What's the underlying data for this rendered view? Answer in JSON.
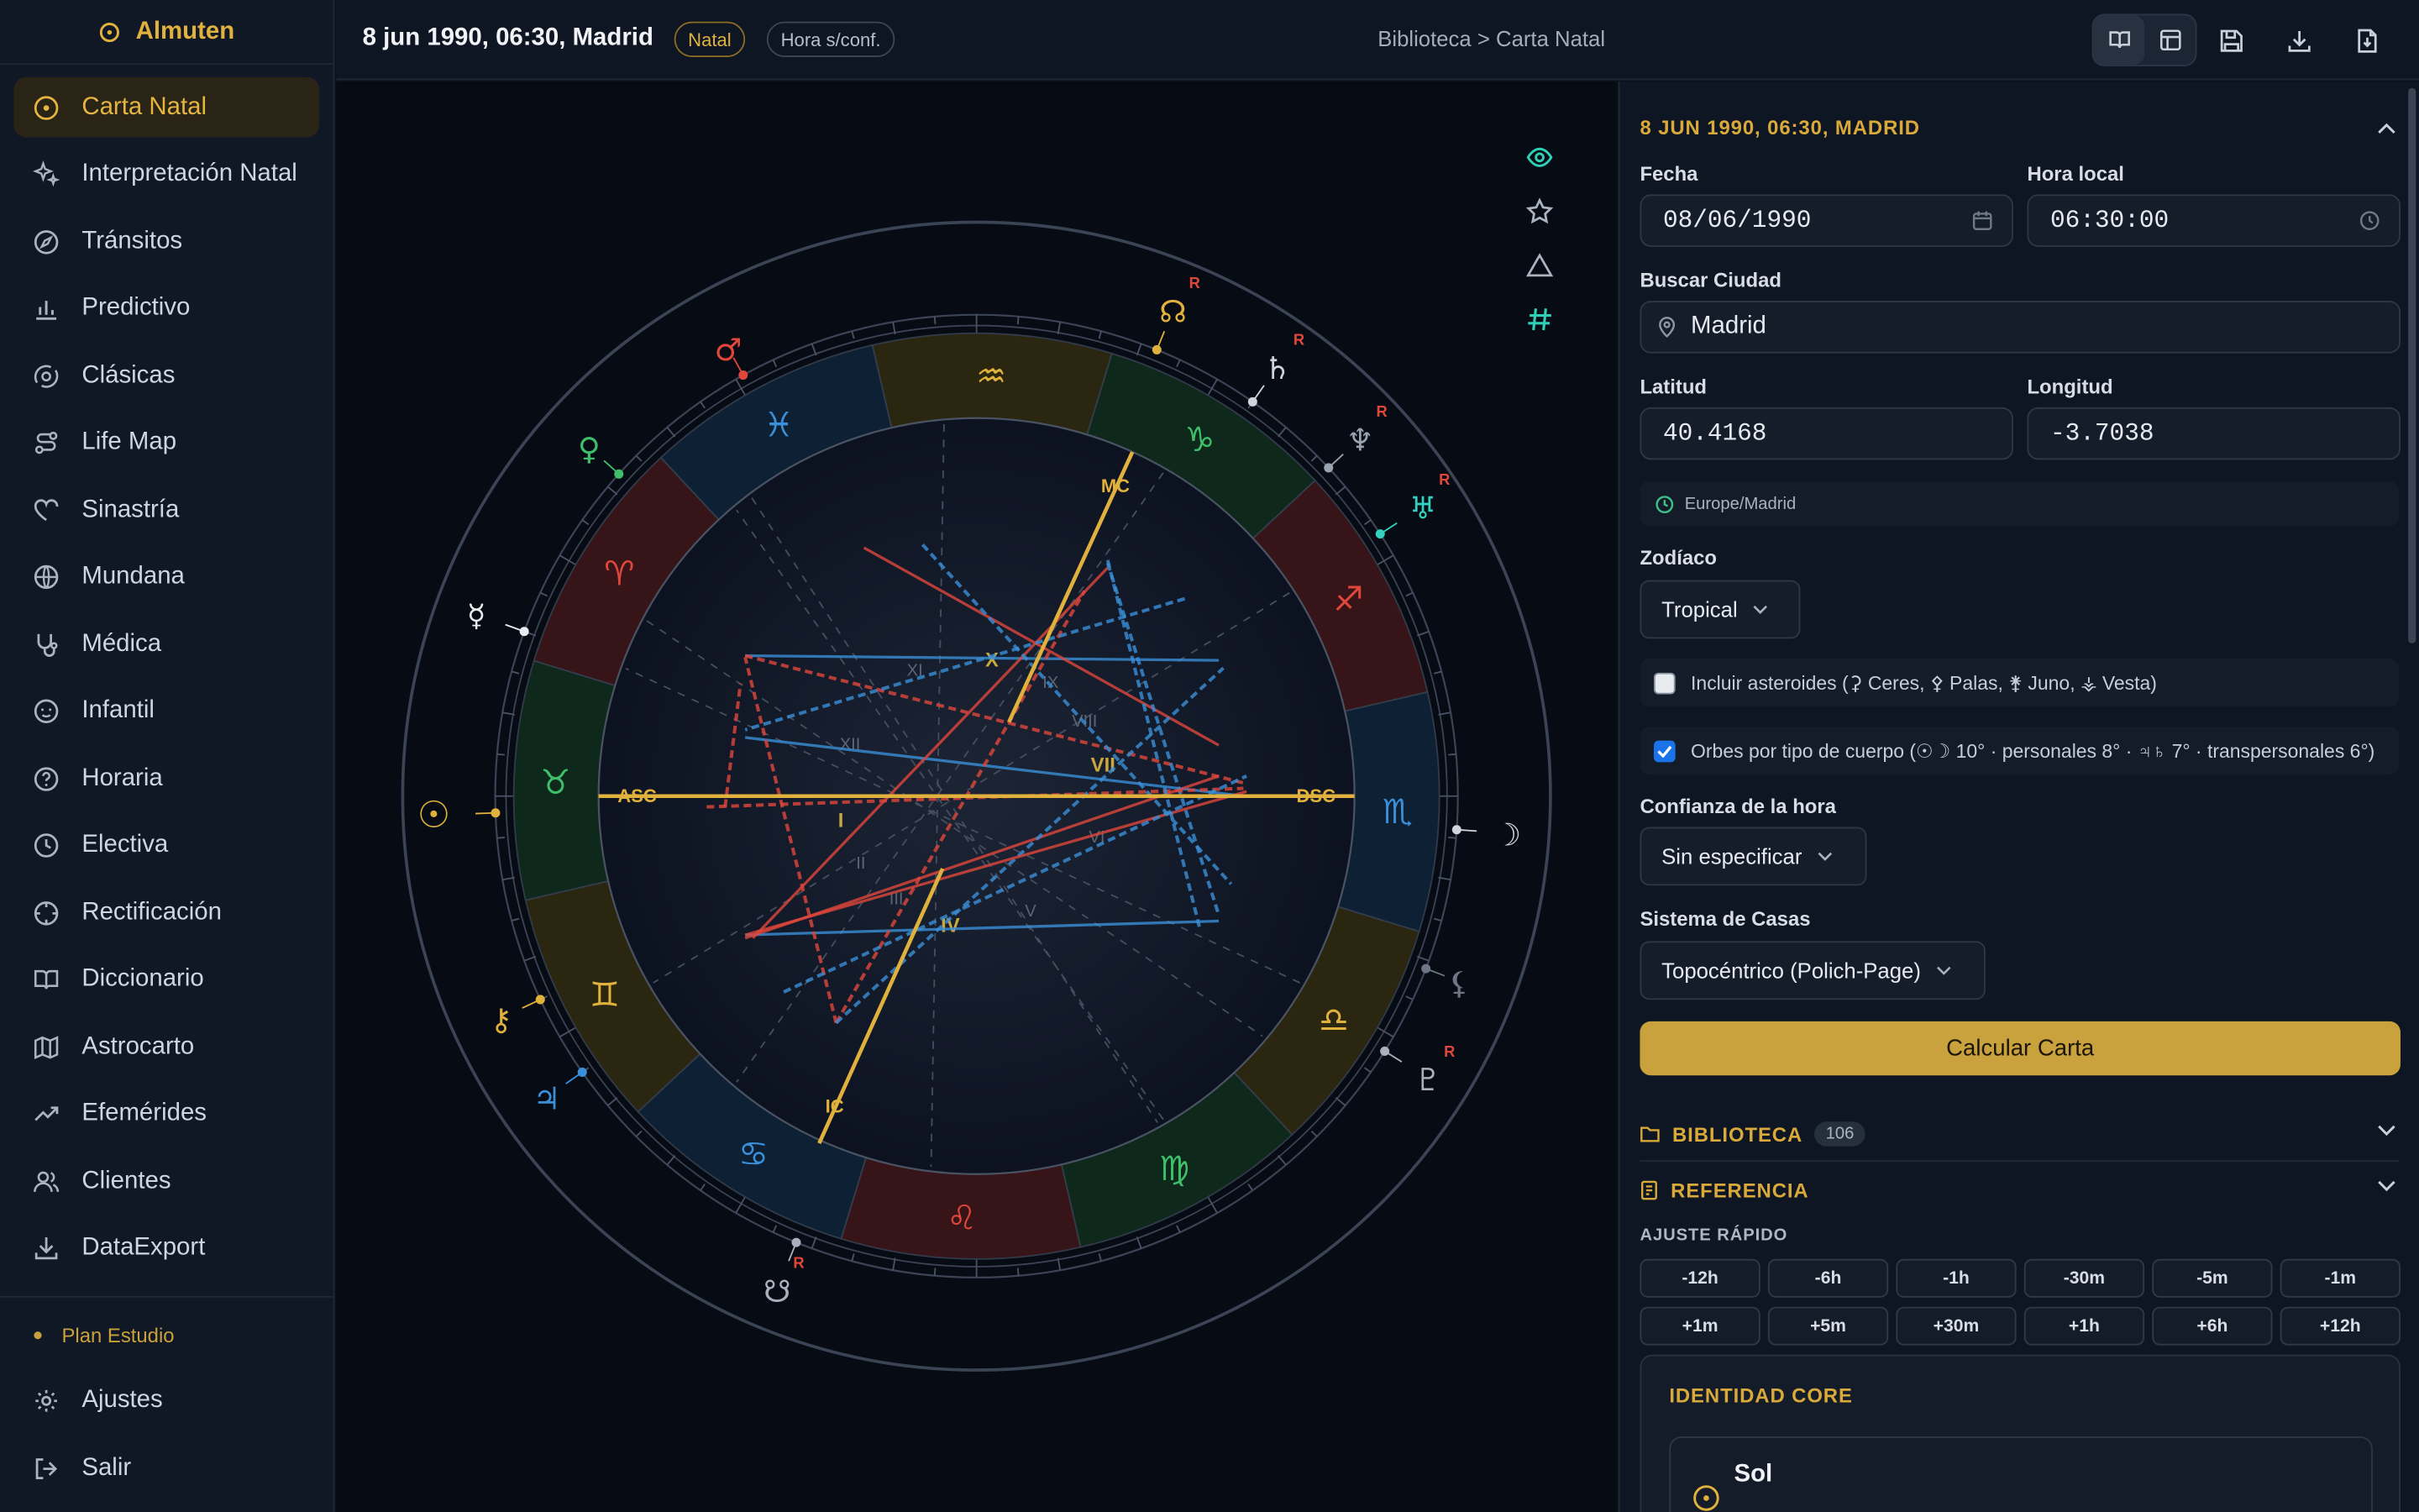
{
  "app": {
    "name": "Almuten"
  },
  "sidebar": {
    "items": [
      {
        "label": "Carta Natal",
        "icon": "circle-dot-icon",
        "active": true
      },
      {
        "label": "Interpretación Natal",
        "icon": "sparkles-icon"
      },
      {
        "label": "Tránsitos",
        "icon": "compass-icon"
      },
      {
        "label": "Predictivo",
        "icon": "bar-chart-icon"
      },
      {
        "label": "Clásicas",
        "icon": "orbit-icon"
      },
      {
        "label": "Life Map",
        "icon": "route-icon"
      },
      {
        "label": "Sinastría",
        "icon": "heart-icon"
      },
      {
        "label": "Mundana",
        "icon": "globe-icon"
      },
      {
        "label": "Médica",
        "icon": "stethoscope-icon"
      },
      {
        "label": "Infantil",
        "icon": "baby-icon"
      },
      {
        "label": "Horaria",
        "icon": "question-circle-icon"
      },
      {
        "label": "Electiva",
        "icon": "clock-icon"
      },
      {
        "label": "Rectificación",
        "icon": "crosshair-icon"
      },
      {
        "label": "Diccionario",
        "icon": "book-open-icon"
      },
      {
        "label": "Astrocarto",
        "icon": "map-icon"
      },
      {
        "label": "Efemérides",
        "icon": "trending-up-icon"
      },
      {
        "label": "Clientes",
        "icon": "users-icon"
      },
      {
        "label": "DataExport",
        "icon": "download-icon"
      }
    ],
    "plan": "Plan Estudio",
    "settings": "Ajustes",
    "logout": "Salir"
  },
  "topbar": {
    "title": "8 jun 1990, 06:30, Madrid",
    "badge_natal": "Natal",
    "badge_hora": "Hora s/conf.",
    "breadcrumb": "Biblioteca > Carta Natal"
  },
  "wheel": {
    "signs": [
      "♈",
      "♉",
      "♊",
      "♋",
      "♌",
      "♍",
      "♎",
      "♏",
      "♐",
      "♑",
      "♒",
      "♓"
    ],
    "angles": {
      "asc": "ASC",
      "dsc": "DSC",
      "mc": "MC",
      "ic": "IC"
    },
    "houses": [
      "I",
      "II",
      "III",
      "IV",
      "V",
      "VI",
      "VII",
      "VIII",
      "IX",
      "X",
      "XI",
      "XII"
    ],
    "retro": "R",
    "planets": {
      "sun": "☉",
      "moon": "☽",
      "mercury": "☿",
      "venus": "♀",
      "mars": "♂",
      "jupiter": "♃",
      "saturn": "♄",
      "uranus": "♅",
      "neptune": "♆",
      "pluto": "♇",
      "node": "☊",
      "south_node": "☋",
      "chiron": "⚷",
      "lilith": "⚸"
    },
    "colors": {
      "gold": "#e0b13c",
      "red": "#e0473c",
      "blue": "#3a8fd8",
      "green": "#3fbf6a",
      "teal": "#33d1c0"
    }
  },
  "panel": {
    "header": "8 JUN 1990, 06:30, MADRID",
    "fecha_label": "Fecha",
    "fecha_value": "08/06/1990",
    "hora_label": "Hora local",
    "hora_value": "06:30:00",
    "ciudad_label": "Buscar Ciudad",
    "ciudad_value": "Madrid",
    "lat_label": "Latitud",
    "lat_value": "40.4168",
    "lon_label": "Longitud",
    "lon_value": "-3.7038",
    "timezone": "Europe/Madrid",
    "zodiac_label": "Zodíaco",
    "zodiac_value": "Tropical",
    "asteroids_label": "Incluir asteroides (⚳ Ceres, ⚴ Palas, ⚵ Juno, ⚶ Vesta)",
    "asteroids_checked": false,
    "orbs_label": "Orbes por tipo de cuerpo (☉☽ 10° · personales 8° · ♃♄ 7° · transpersonales 6°)",
    "orbs_checked": true,
    "confianza_label": "Confianza de la hora",
    "confianza_value": "Sin especificar",
    "casas_label": "Sistema de Casas",
    "casas_value": "Topocéntrico (Polich-Page)",
    "calc_button": "Calcular Carta",
    "biblioteca": "BIBLIOTECA",
    "biblioteca_count": "106",
    "referencia": "REFERENCIA",
    "ajuste_label": "AJUSTE RÁPIDO",
    "adjust_minus": [
      "-12h",
      "-6h",
      "-1h",
      "-30m",
      "-5m",
      "-1m"
    ],
    "adjust_plus": [
      "+1m",
      "+5m",
      "+30m",
      "+1h",
      "+6h",
      "+12h"
    ],
    "core_title": "IDENTIDAD CORE",
    "core_first": "Sol"
  }
}
